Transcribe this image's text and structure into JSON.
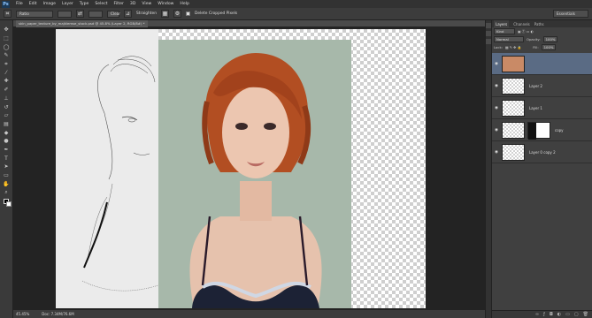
{
  "menu": [
    "File",
    "Edit",
    "Image",
    "Layer",
    "Type",
    "Select",
    "Filter",
    "3D",
    "View",
    "Window",
    "Help"
  ],
  "app_logo": "Ps",
  "options": {
    "ratio": "Ratio",
    "clear": "Clear",
    "straighten": "Straighten",
    "delete_cropped": "Delete Cropped Pixels"
  },
  "workspace": "Essentials",
  "doc_tab": "skin_paper_texture_by_majklemse_stock.psd @ 45.8% (Layer 2, RGB/8#) *",
  "status": {
    "zoom": "45.45%",
    "doc": "Doc: 7.34M/76.6M"
  },
  "panel": {
    "tabs": [
      "Layers",
      "Channels",
      "Paths"
    ],
    "kind": "Kind",
    "blend": "Normal",
    "opacity_label": "Opacity:",
    "opacity": "100%",
    "lock_label": "Lock:",
    "fill_label": "Fill:",
    "fill": "100%"
  },
  "layers": [
    {
      "name": "",
      "thumb": "photo",
      "selected": true
    },
    {
      "name": "Layer 2",
      "thumb": "blank",
      "selected": false
    },
    {
      "name": "Layer 1",
      "thumb": "blank",
      "selected": false
    },
    {
      "name": "copy",
      "thumb": "mask",
      "selected": false
    },
    {
      "name": "Layer 0 copy 2",
      "thumb": "blank",
      "selected": false
    }
  ],
  "tools": [
    "move-icon",
    "marquee-icon",
    "lasso-icon",
    "quick-select-icon",
    "crop-icon",
    "eyedropper-icon",
    "healing-icon",
    "brush-icon",
    "stamp-icon",
    "history-brush-icon",
    "eraser-icon",
    "gradient-icon",
    "blur-icon",
    "dodge-icon",
    "pen-icon",
    "type-icon",
    "path-select-icon",
    "shape-icon",
    "hand-icon",
    "zoom-icon"
  ]
}
